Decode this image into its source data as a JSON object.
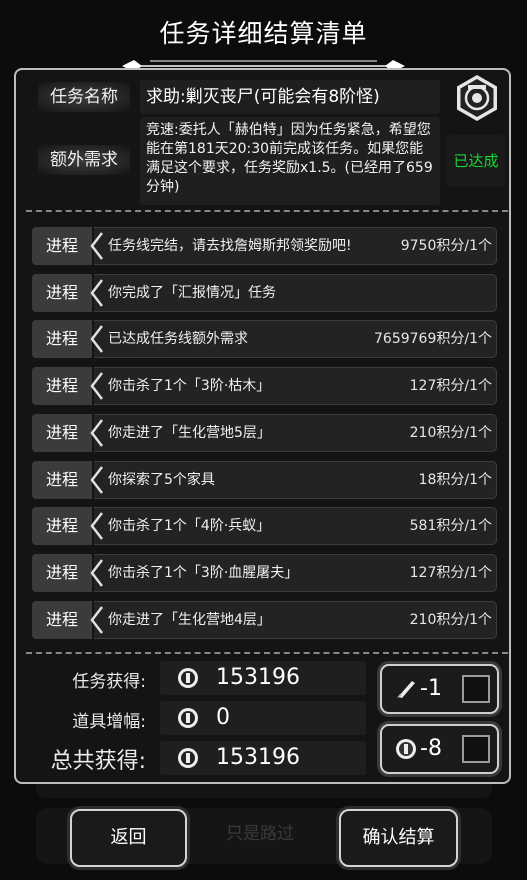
{
  "title": "任务详细结算清单",
  "task": {
    "name_label": "任务名称",
    "name_value": "求助:剿灭丧尸(可能会有8阶怪)",
    "extra_label": "额外需求",
    "extra_value": "竞速:委托人「赫伯特」因为任务紧急，希望您能在第181天20:30前完成该任务。如果您能满足这个要求，任务奖励x1.5。(已经用了659分钟)",
    "extra_status": "已达成"
  },
  "progress_rows": [
    {
      "tag": "进程",
      "text": "任务线完结，请去找詹姆斯邦领奖励吧!",
      "points": "9750积分/1个"
    },
    {
      "tag": "进程",
      "text": "你完成了「汇报情况」任务",
      "points": ""
    },
    {
      "tag": "进程",
      "text": "已达成任务线额外需求",
      "points": "7659769积分/1个"
    },
    {
      "tag": "进程",
      "text": "你击杀了1个「3阶·枯木」",
      "points": "127积分/1个"
    },
    {
      "tag": "进程",
      "text": "你走进了「生化营地5层」",
      "points": "210积分/1个"
    },
    {
      "tag": "进程",
      "text": "你探索了5个家具",
      "points": "18积分/1个"
    },
    {
      "tag": "进程",
      "text": "你击杀了1个「4阶·兵蚁」",
      "points": "581积分/1个"
    },
    {
      "tag": "进程",
      "text": "你击杀了1个「3阶·血腥屠夫」",
      "points": "127积分/1个"
    },
    {
      "tag": "进程",
      "text": "你走进了「生化营地4层」",
      "points": "210积分/1个"
    }
  ],
  "summary": {
    "earned_label": "任务获得:",
    "earned_value": "153196",
    "bonus_label": "道具增幅:",
    "bonus_value": "0",
    "total_label": "总共获得:",
    "total_value": "153196"
  },
  "items": [
    {
      "icon": "scroll-quill-icon",
      "count": "-1"
    },
    {
      "icon": "coin-badge-icon",
      "count": "-8"
    }
  ],
  "buttons": {
    "back": "返回",
    "ghost": "只是路过",
    "confirm": "确认结算"
  }
}
